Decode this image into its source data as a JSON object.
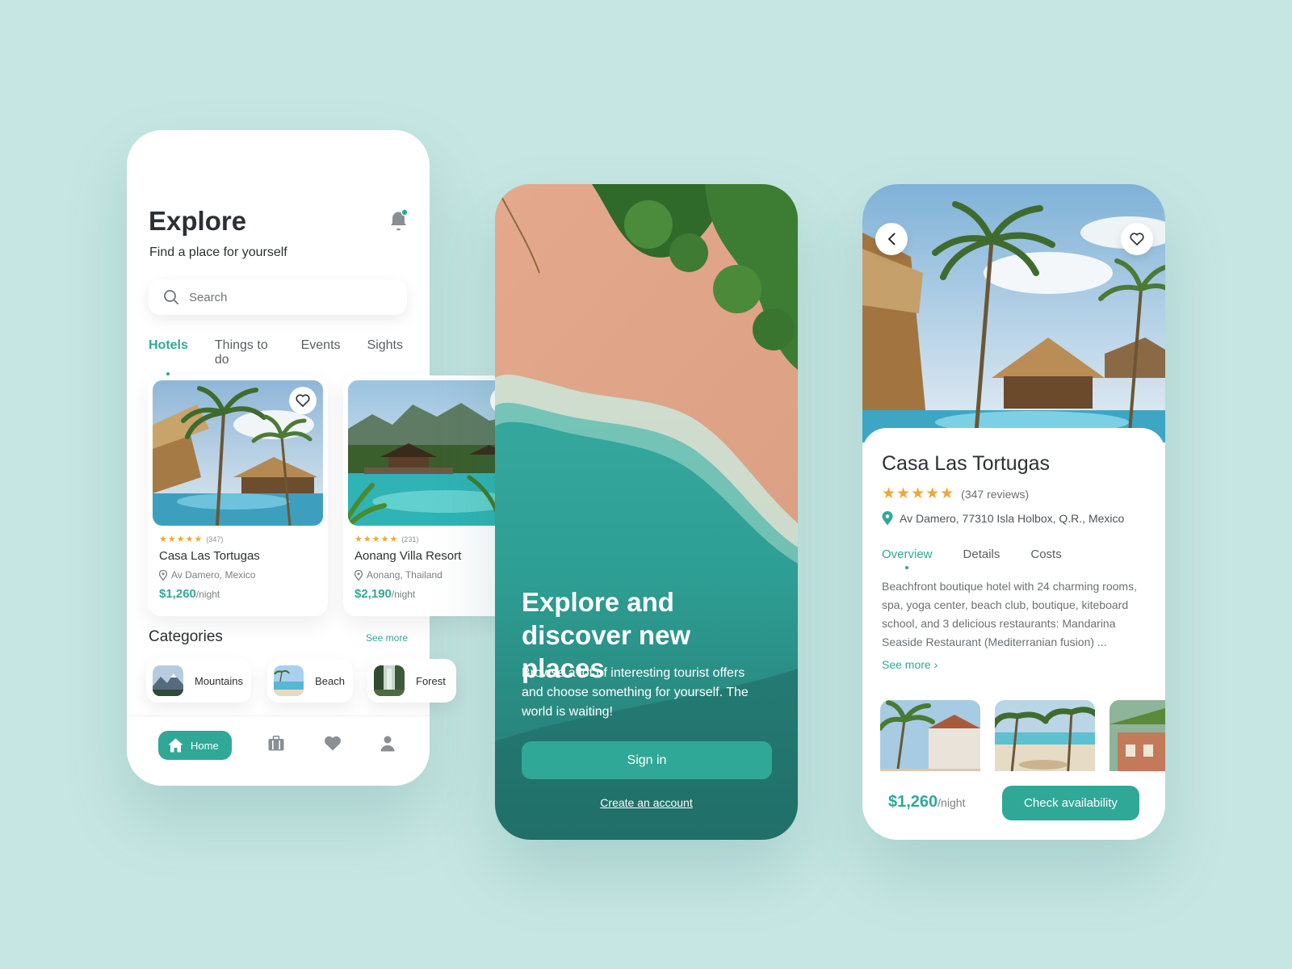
{
  "colors": {
    "accent": "#2fa897",
    "star": "#f0a63a",
    "background": "#c6e6e3"
  },
  "explore": {
    "title": "Explore",
    "subtitle": "Find a place for yourself",
    "search_placeholder": "Search",
    "tabs": [
      {
        "label": "Hotels",
        "active": true
      },
      {
        "label": "Things to do",
        "active": false
      },
      {
        "label": "Events",
        "active": false
      },
      {
        "label": "Sights",
        "active": false
      }
    ],
    "hotels": [
      {
        "name": "Casa Las Tortugas",
        "reviews": "(347)",
        "location": "Av Damero, Mexico",
        "price": "$1,260",
        "unit": "/night",
        "rating": 5
      },
      {
        "name": "Aonang Villa Resort",
        "reviews": "(231)",
        "location": "Aonang, Thailand",
        "price": "$2,190",
        "unit": "/night",
        "rating": 5
      }
    ],
    "categories_title": "Categories",
    "see_more": "See more",
    "categories": [
      "Mountains",
      "Beach",
      "Forest"
    ],
    "nav": {
      "home": "Home",
      "icons": [
        "home-icon",
        "briefcase-icon",
        "heart-icon",
        "user-icon"
      ]
    }
  },
  "welcome": {
    "headline": "Explore and discover new places",
    "description": "Browse a lot of interesting tourist offers and choose something for yourself. The world is waiting!",
    "sign_in": "Sign in",
    "create_account": "Create an account"
  },
  "details": {
    "name": "Casa Las Tortugas",
    "rating": 5,
    "reviews": "(347 reviews)",
    "address": "Av Damero, 77310 Isla Holbox, Q.R., Mexico",
    "tabs": [
      {
        "label": "Overview",
        "active": true
      },
      {
        "label": "Details",
        "active": false
      },
      {
        "label": "Costs",
        "active": false
      }
    ],
    "about": "Beachfront boutique hotel with 24 charming rooms, spa, yoga center, beach club, boutique, kiteboard school, and 3 delicious restaurants: Mandarina Seaside Restaurant (Mediterranian fusion) ...",
    "see_more": "See more ›",
    "price": "$1,260",
    "unit": "/night",
    "cta": "Check availability"
  }
}
